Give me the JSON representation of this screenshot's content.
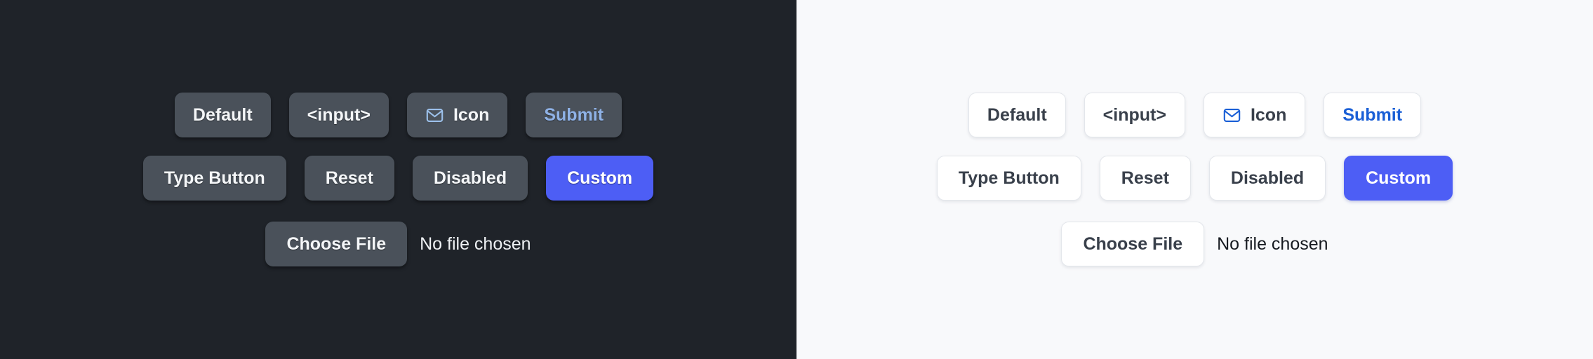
{
  "theme": {
    "dark": {
      "background": "#1f2329",
      "button_fill": "#4a515a",
      "button_text": "#f4f6f8",
      "submit_text": "#8fb2e6",
      "icon_color": "#9cc0ea",
      "custom_fill": "#4d5ef5",
      "custom_text": "#ffffff",
      "file_status_text": "#eef1f4"
    },
    "light": {
      "background": "#f8f9fb",
      "button_fill": "#ffffff",
      "button_border": "#e3e6eb",
      "button_text": "#39404b",
      "submit_text": "#1a5fd6",
      "icon_color": "#1a5fd6",
      "custom_fill": "#4d5ef5",
      "custom_text": "#ffffff",
      "file_status_text": "#161a20"
    }
  },
  "buttons": {
    "default": "Default",
    "input": "<input>",
    "icon": "Icon",
    "submit": "Submit",
    "type_button": "Type Button",
    "reset": "Reset",
    "disabled": "Disabled",
    "custom": "Custom",
    "choose_file": "Choose File"
  },
  "file_input": {
    "status": "No file chosen"
  },
  "icons": {
    "mail": "mail-icon"
  }
}
